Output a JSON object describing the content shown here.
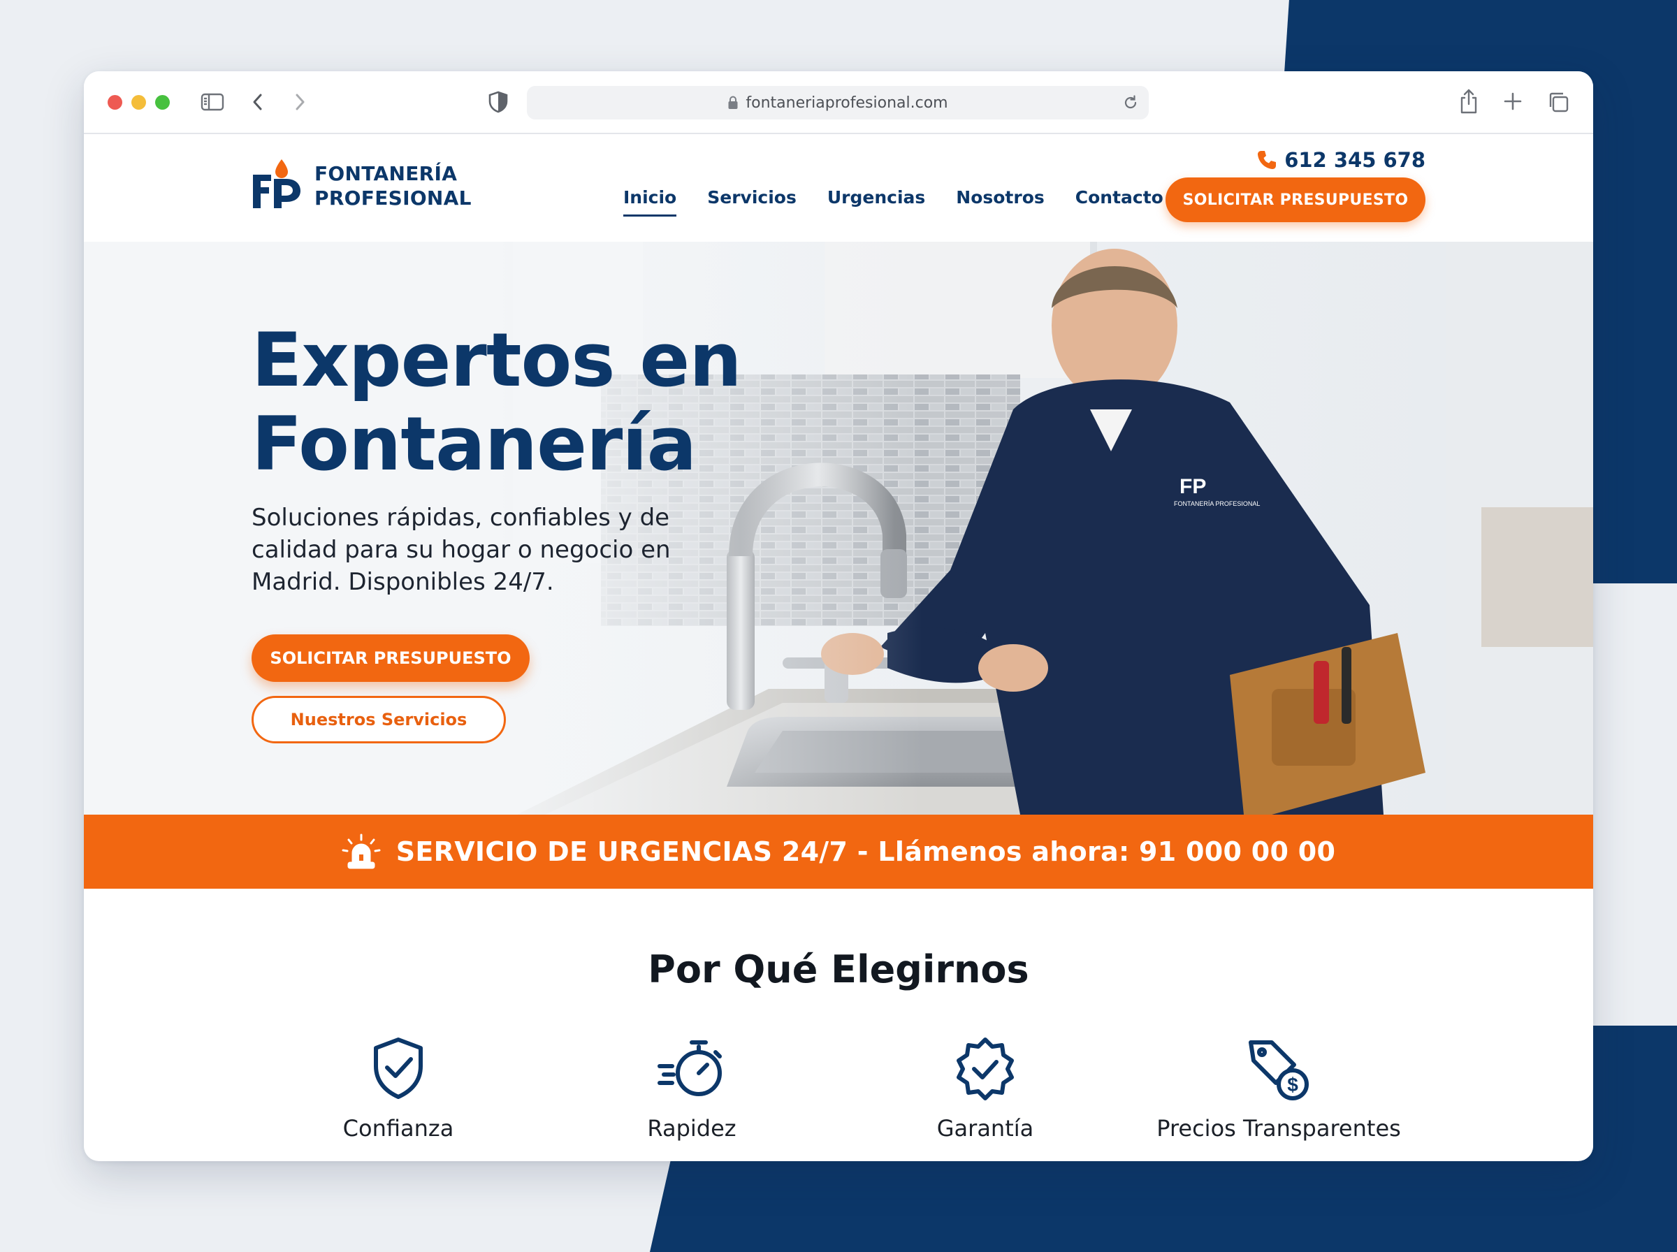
{
  "browser": {
    "url": "fontaneriaprofesional.com"
  },
  "header": {
    "logo_line1": "FONTANERÍA",
    "logo_line2": "PROFESIONAL",
    "phone": "612 345 678",
    "nav": [
      {
        "label": "Inicio",
        "active": true
      },
      {
        "label": "Servicios",
        "active": false
      },
      {
        "label": "Urgencias",
        "active": false
      },
      {
        "label": "Nosotros",
        "active": false
      },
      {
        "label": "Contacto",
        "active": false
      }
    ],
    "cta_label": "SOLICITAR PRESUPUESTO"
  },
  "hero": {
    "title_line1": "Expertos en",
    "title_line2": "Fontanería",
    "subtitle": "Soluciones rápidas, confiables y de calidad para su hogar o negocio en Madrid. Disponibles 24/7.",
    "primary_button": "SOLICITAR PRESUPUESTO",
    "secondary_button": "Nuestros Servicios",
    "image_icon": "plumber-at-kitchen-sink-image",
    "shirt_logo_text": "FONTANERÍA PROFESIONAL"
  },
  "banner": {
    "text": "SERVICIO DE URGENCIAS 24/7 - Llámenos ahora: 91 000 00 00",
    "icon": "siren-icon"
  },
  "features": {
    "title": "Por Qué Elegirnos",
    "items": [
      {
        "label": "Confianza",
        "icon": "shield-check-icon"
      },
      {
        "label": "Rapidez",
        "icon": "stopwatch-icon"
      },
      {
        "label": "Garantía",
        "icon": "badge-check-icon"
      },
      {
        "label": "Precios Transparentes",
        "icon": "price-tag-icon"
      }
    ]
  },
  "colors": {
    "navy": "#0c3769",
    "orange": "#f26711",
    "background": "#eceff3"
  }
}
